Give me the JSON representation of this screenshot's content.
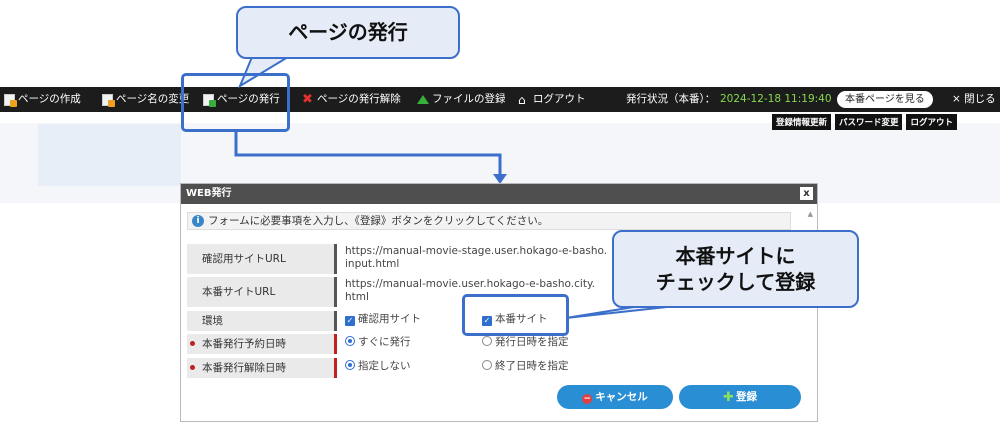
{
  "toolbar": {
    "items": [
      {
        "label": "ページの作成"
      },
      {
        "label": "ページ名の変更"
      },
      {
        "label": "ページの発行"
      },
      {
        "label": "ページの発行解除"
      },
      {
        "label": "ファイルの登録"
      },
      {
        "label": "ログアウト"
      }
    ],
    "status_label": "発行状況（本番）：",
    "status_time": "2024-12-18 11:19:40",
    "view_live_label": "本番ページを見る",
    "close_label": "× 閉じる"
  },
  "sub_links": {
    "update_registration": "登録情報更新",
    "change_password": "パスワード変更",
    "logout": "ログアウト"
  },
  "callouts": {
    "top": "ページの発行",
    "right_line1": "本番サイトに",
    "right_line2": "チェックして登録"
  },
  "dialog": {
    "title": "WEB発行",
    "close_glyph": "x",
    "message": "フォームに必要事項を入力し、《登録》ボタンをクリックしてください。",
    "rows": {
      "confirm_url": {
        "label": "確認用サイトURL",
        "value_line1": "https://manual-movie-stage.user.hokago-e-basho.",
        "value_line2": "input.html"
      },
      "live_url": {
        "label": "本番サイトURL",
        "value_line1": "https://manual-movie.user.hokago-e-basho.city.",
        "value_line2": "html"
      },
      "env": {
        "label": "環境",
        "option1": "確認用サイト",
        "option2": "本番サイト"
      },
      "publish_schedule": {
        "label": "本番発行予約日時",
        "option1": "すぐに発行",
        "option2": "発行日時を指定"
      },
      "unpublish_schedule": {
        "label": "本番発行解除日時",
        "option1": "指定しない",
        "option2": "終了日時を指定"
      }
    },
    "cancel_label": "キャンセル",
    "save_label": "登録"
  }
}
